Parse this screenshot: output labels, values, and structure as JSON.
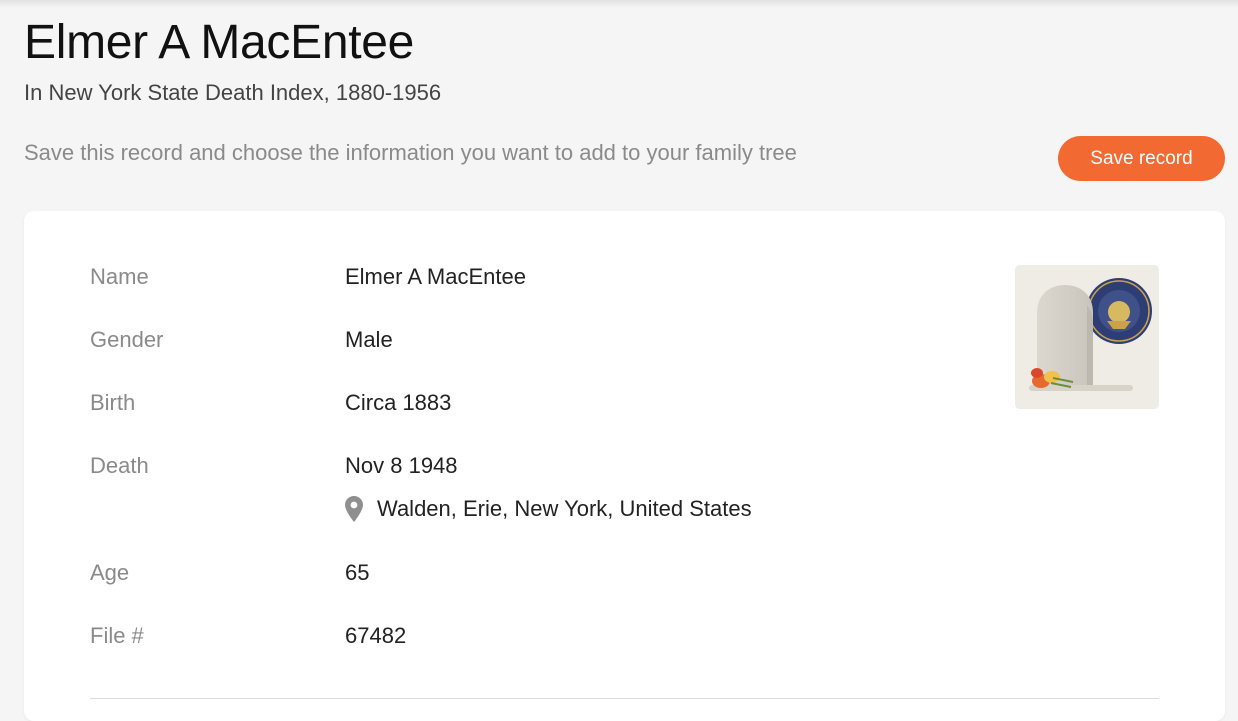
{
  "header": {
    "title": "Elmer A MacEntee",
    "subtitle": "In New York State Death Index, 1880-1956",
    "save_hint": "Save this record and choose the information you want to add to your family tree",
    "save_button_label": "Save record"
  },
  "record": {
    "fields": [
      {
        "label": "Name",
        "value": "Elmer A MacEntee"
      },
      {
        "label": "Gender",
        "value": "Male"
      },
      {
        "label": "Birth",
        "value": "Circa 1883"
      },
      {
        "label": "Death",
        "value": "Nov 8 1948",
        "place": "Walden, Erie, New York, United States"
      },
      {
        "label": "Age",
        "value": "65"
      },
      {
        "label": "File #",
        "value": "67482"
      }
    ],
    "place_icon": "location-pin-icon",
    "thumbnail_icon": "gravestone-seal-icon"
  },
  "colors": {
    "accent": "#f26a32",
    "label_gray": "#8a8a8a",
    "background": "#f5f5f5"
  }
}
